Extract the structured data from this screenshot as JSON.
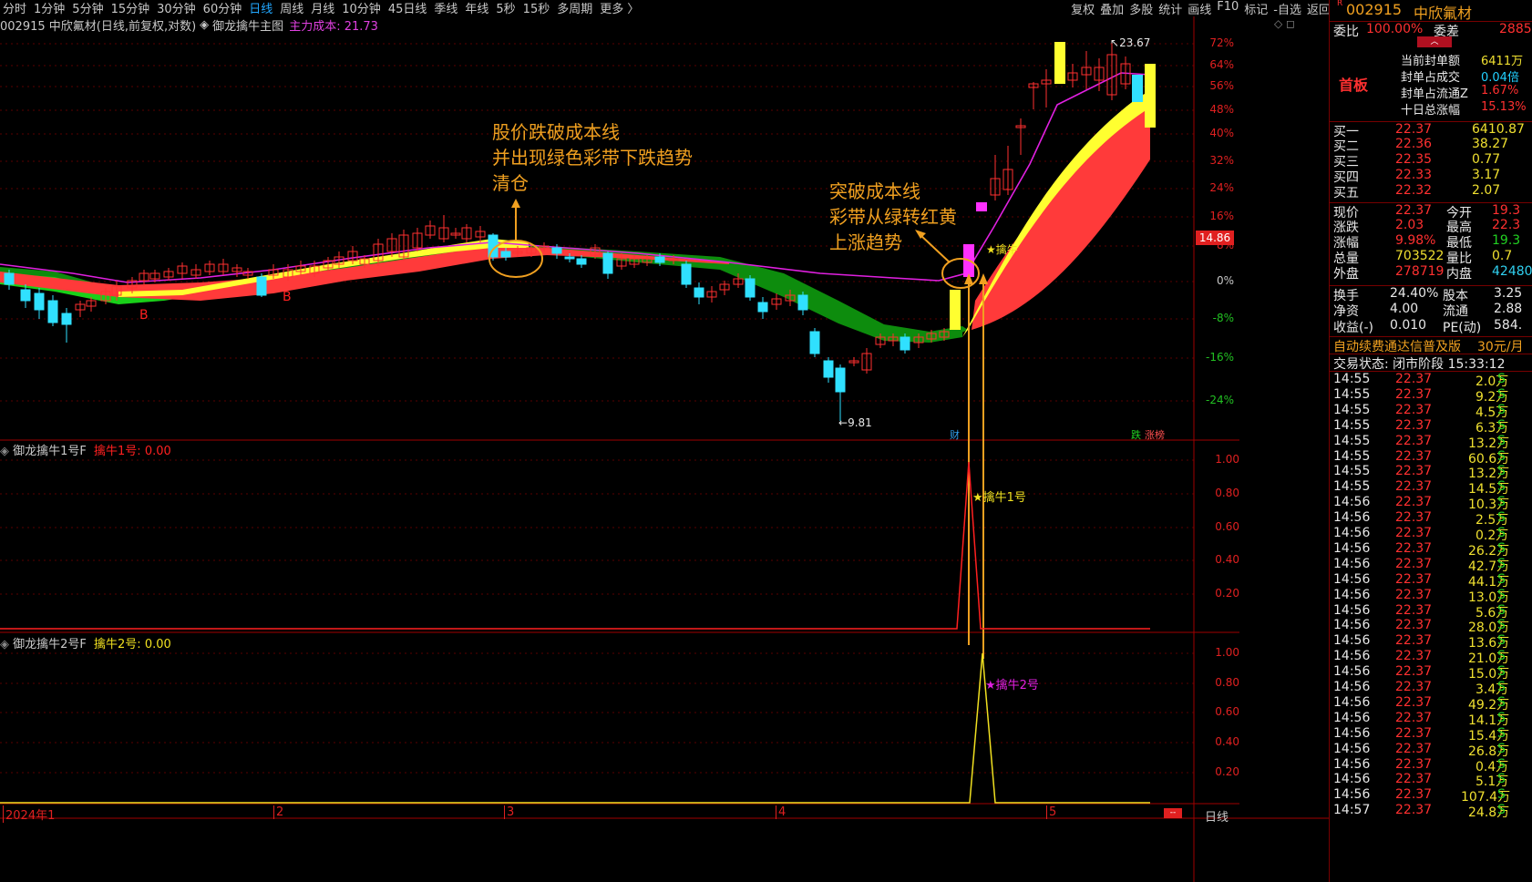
{
  "toolbar": {
    "timeframes": [
      "分时",
      "1分钟",
      "5分钟",
      "15分钟",
      "30分钟",
      "60分钟",
      "日线",
      "周线",
      "月线",
      "10分钟",
      "45日线",
      "季线",
      "年线",
      "5秒",
      "15秒",
      "多周期",
      "更多 〉"
    ],
    "active_timeframe": "日线",
    "tools": [
      "复权",
      "叠加",
      "多股",
      "统计",
      "画线",
      "F10",
      "标记",
      "-自选",
      "返回"
    ]
  },
  "chart_header": {
    "stock": "002915 中欣氟材(日线,前复权,对数)",
    "indicator": "御龙擒牛主图",
    "cost_label": "主力成本: 21.73"
  },
  "price_axis": [
    "72%",
    "64%",
    "56%",
    "48%",
    "40%",
    "32%",
    "24%",
    "16%",
    "8%",
    "0%",
    "-8%",
    "-16%",
    "-24%"
  ],
  "price_badge": "14.86",
  "markers": {
    "high": "23.67",
    "low": "9.81",
    "b1": "B",
    "b2": "B",
    "catch": "★擒牛",
    "cai": "财",
    "die": "跌",
    "zhangbang": "涨榜"
  },
  "annotations": {
    "a1": [
      "股价跌破成本线",
      "并出现绿色彩带下跌趋势",
      "清仓"
    ],
    "a2": [
      "突破成本线",
      "彩带从绿转红黄",
      "上涨趋势"
    ]
  },
  "sub1": {
    "title": "御龙擒牛1号F",
    "value_label": "擒牛1号: 0.00",
    "marker": "★擒牛1号",
    "axis": [
      "1.00",
      "0.80",
      "0.60",
      "0.40",
      "0.20"
    ]
  },
  "sub2": {
    "title": "御龙擒牛2号F",
    "value_label": "擒牛2号: 0.00",
    "marker": "★擒牛2号",
    "axis": [
      "1.00",
      "0.80",
      "0.60",
      "0.40",
      "0.20"
    ]
  },
  "time_axis": [
    "2024年1",
    "2",
    "3",
    "4",
    "5"
  ],
  "bottom_tab": "日线",
  "right_panel": {
    "code": "002915",
    "name": "中欣氟材",
    "weibi_label": "委比",
    "weibi_value": "100.00%",
    "weicha_label": "委差",
    "weicha_value": "2885",
    "shouban": "首板",
    "seal": [
      {
        "label": "当前封单额",
        "value": "6411万"
      },
      {
        "label": "封单占成交",
        "value": "0.04倍"
      },
      {
        "label": "封单占流通Z",
        "value": "1.67%"
      },
      {
        "label": "十日总涨幅",
        "value": "15.13%"
      }
    ],
    "bids": [
      {
        "label": "买一",
        "price": "22.37",
        "vol": "6410.87"
      },
      {
        "label": "买二",
        "price": "22.36",
        "vol": "38.27"
      },
      {
        "label": "买三",
        "price": "22.35",
        "vol": "0.77"
      },
      {
        "label": "买四",
        "price": "22.33",
        "vol": "3.17"
      },
      {
        "label": "买五",
        "price": "22.32",
        "vol": "2.07"
      }
    ],
    "quote": [
      {
        "l1": "现价",
        "v1": "22.37",
        "l2": "今开",
        "v2": "19.3"
      },
      {
        "l1": "涨跌",
        "v1": "2.03",
        "l2": "最高",
        "v2": "22.3"
      },
      {
        "l1": "涨幅",
        "v1": "9.98%",
        "l2": "最低",
        "v2": "19.3"
      },
      {
        "l1": "总量",
        "v1": "703522",
        "l2": "量比",
        "v2": "0.7"
      },
      {
        "l1": "外盘",
        "v1": "278719",
        "l2": "内盘",
        "v2": "42480"
      }
    ],
    "stats": [
      {
        "l1": "换手",
        "v1": "24.40%",
        "l2": "股本",
        "v2": "3.25"
      },
      {
        "l1": "净资",
        "v1": "4.00",
        "l2": "流通",
        "v2": "2.88"
      },
      {
        "l1": "收益(-)",
        "v1": "0.010",
        "l2": "PE(动)",
        "v2": "584."
      }
    ],
    "promo": "自动续费通达信普及版",
    "promo_price": "30元/月",
    "status": "交易状态: 闭市阶段 15:33:12",
    "ticks": [
      {
        "t": "14:55",
        "p": "22.37",
        "v": "2.0万",
        "s": "S"
      },
      {
        "t": "14:55",
        "p": "22.37",
        "v": "9.2万",
        "s": "S"
      },
      {
        "t": "14:55",
        "p": "22.37",
        "v": "4.5万",
        "s": "S"
      },
      {
        "t": "14:55",
        "p": "22.37",
        "v": "6.3万",
        "s": "S"
      },
      {
        "t": "14:55",
        "p": "22.37",
        "v": "13.2万",
        "s": "S"
      },
      {
        "t": "14:55",
        "p": "22.37",
        "v": "60.6万",
        "s": "S"
      },
      {
        "t": "14:55",
        "p": "22.37",
        "v": "13.2万",
        "s": "S"
      },
      {
        "t": "14:55",
        "p": "22.37",
        "v": "14.5万",
        "s": "S"
      },
      {
        "t": "14:56",
        "p": "22.37",
        "v": "10.3万",
        "s": "S"
      },
      {
        "t": "14:56",
        "p": "22.37",
        "v": "2.5万",
        "s": "S"
      },
      {
        "t": "14:56",
        "p": "22.37",
        "v": "0.2万",
        "s": "S"
      },
      {
        "t": "14:56",
        "p": "22.37",
        "v": "26.2万",
        "s": "S"
      },
      {
        "t": "14:56",
        "p": "22.37",
        "v": "42.7万",
        "s": "S"
      },
      {
        "t": "14:56",
        "p": "22.37",
        "v": "44.1万",
        "s": "S"
      },
      {
        "t": "14:56",
        "p": "22.37",
        "v": "13.0万",
        "s": "S"
      },
      {
        "t": "14:56",
        "p": "22.37",
        "v": "5.6万",
        "s": "S"
      },
      {
        "t": "14:56",
        "p": "22.37",
        "v": "28.0万",
        "s": "S"
      },
      {
        "t": "14:56",
        "p": "22.37",
        "v": "13.6万",
        "s": "S"
      },
      {
        "t": "14:56",
        "p": "22.37",
        "v": "21.0万",
        "s": "S"
      },
      {
        "t": "14:56",
        "p": "22.37",
        "v": "15.0万",
        "s": "S"
      },
      {
        "t": "14:56",
        "p": "22.37",
        "v": "3.4万",
        "s": "S"
      },
      {
        "t": "14:56",
        "p": "22.37",
        "v": "49.2万",
        "s": "S"
      },
      {
        "t": "14:56",
        "p": "22.37",
        "v": "14.1万",
        "s": "S"
      },
      {
        "t": "14:56",
        "p": "22.37",
        "v": "15.4万",
        "s": "S"
      },
      {
        "t": "14:56",
        "p": "22.37",
        "v": "26.8万",
        "s": "S"
      },
      {
        "t": "14:56",
        "p": "22.37",
        "v": "0.4万",
        "s": "S"
      },
      {
        "t": "14:56",
        "p": "22.37",
        "v": "5.1万",
        "s": "S"
      },
      {
        "t": "14:56",
        "p": "22.37",
        "v": "107.4万",
        "s": "S"
      },
      {
        "t": "14:57",
        "p": "22.37",
        "v": "24.8万",
        "s": "S"
      }
    ]
  }
}
